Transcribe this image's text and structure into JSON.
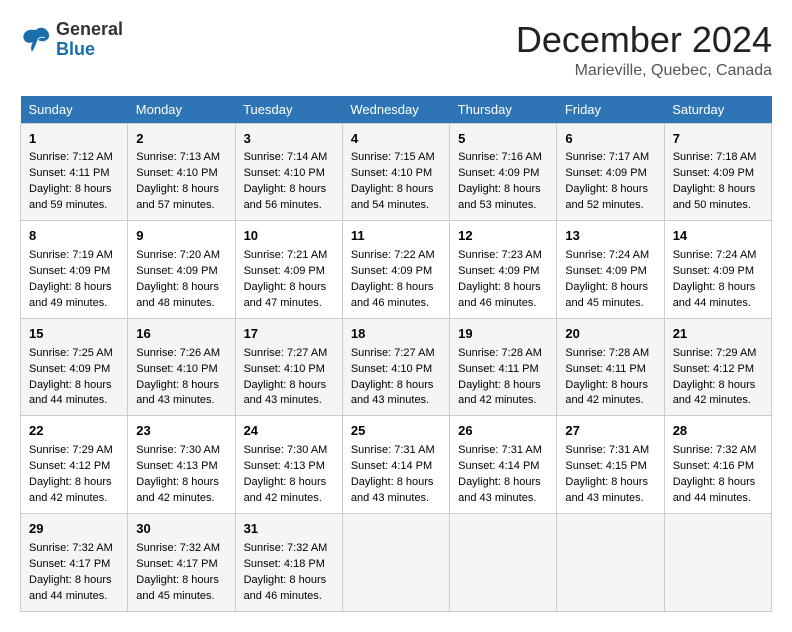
{
  "header": {
    "logo_general": "General",
    "logo_blue": "Blue",
    "month_year": "December 2024",
    "location": "Marieville, Quebec, Canada"
  },
  "days_of_week": [
    "Sunday",
    "Monday",
    "Tuesday",
    "Wednesday",
    "Thursday",
    "Friday",
    "Saturday"
  ],
  "weeks": [
    [
      {
        "day": 1,
        "sunrise": "7:12 AM",
        "sunset": "4:11 PM",
        "daylight": "8 hours and 59 minutes."
      },
      {
        "day": 2,
        "sunrise": "7:13 AM",
        "sunset": "4:10 PM",
        "daylight": "8 hours and 57 minutes."
      },
      {
        "day": 3,
        "sunrise": "7:14 AM",
        "sunset": "4:10 PM",
        "daylight": "8 hours and 56 minutes."
      },
      {
        "day": 4,
        "sunrise": "7:15 AM",
        "sunset": "4:10 PM",
        "daylight": "8 hours and 54 minutes."
      },
      {
        "day": 5,
        "sunrise": "7:16 AM",
        "sunset": "4:09 PM",
        "daylight": "8 hours and 53 minutes."
      },
      {
        "day": 6,
        "sunrise": "7:17 AM",
        "sunset": "4:09 PM",
        "daylight": "8 hours and 52 minutes."
      },
      {
        "day": 7,
        "sunrise": "7:18 AM",
        "sunset": "4:09 PM",
        "daylight": "8 hours and 50 minutes."
      }
    ],
    [
      {
        "day": 8,
        "sunrise": "7:19 AM",
        "sunset": "4:09 PM",
        "daylight": "8 hours and 49 minutes."
      },
      {
        "day": 9,
        "sunrise": "7:20 AM",
        "sunset": "4:09 PM",
        "daylight": "8 hours and 48 minutes."
      },
      {
        "day": 10,
        "sunrise": "7:21 AM",
        "sunset": "4:09 PM",
        "daylight": "8 hours and 47 minutes."
      },
      {
        "day": 11,
        "sunrise": "7:22 AM",
        "sunset": "4:09 PM",
        "daylight": "8 hours and 46 minutes."
      },
      {
        "day": 12,
        "sunrise": "7:23 AM",
        "sunset": "4:09 PM",
        "daylight": "8 hours and 46 minutes."
      },
      {
        "day": 13,
        "sunrise": "7:24 AM",
        "sunset": "4:09 PM",
        "daylight": "8 hours and 45 minutes."
      },
      {
        "day": 14,
        "sunrise": "7:24 AM",
        "sunset": "4:09 PM",
        "daylight": "8 hours and 44 minutes."
      }
    ],
    [
      {
        "day": 15,
        "sunrise": "7:25 AM",
        "sunset": "4:09 PM",
        "daylight": "8 hours and 44 minutes."
      },
      {
        "day": 16,
        "sunrise": "7:26 AM",
        "sunset": "4:10 PM",
        "daylight": "8 hours and 43 minutes."
      },
      {
        "day": 17,
        "sunrise": "7:27 AM",
        "sunset": "4:10 PM",
        "daylight": "8 hours and 43 minutes."
      },
      {
        "day": 18,
        "sunrise": "7:27 AM",
        "sunset": "4:10 PM",
        "daylight": "8 hours and 43 minutes."
      },
      {
        "day": 19,
        "sunrise": "7:28 AM",
        "sunset": "4:11 PM",
        "daylight": "8 hours and 42 minutes."
      },
      {
        "day": 20,
        "sunrise": "7:28 AM",
        "sunset": "4:11 PM",
        "daylight": "8 hours and 42 minutes."
      },
      {
        "day": 21,
        "sunrise": "7:29 AM",
        "sunset": "4:12 PM",
        "daylight": "8 hours and 42 minutes."
      }
    ],
    [
      {
        "day": 22,
        "sunrise": "7:29 AM",
        "sunset": "4:12 PM",
        "daylight": "8 hours and 42 minutes."
      },
      {
        "day": 23,
        "sunrise": "7:30 AM",
        "sunset": "4:13 PM",
        "daylight": "8 hours and 42 minutes."
      },
      {
        "day": 24,
        "sunrise": "7:30 AM",
        "sunset": "4:13 PM",
        "daylight": "8 hours and 42 minutes."
      },
      {
        "day": 25,
        "sunrise": "7:31 AM",
        "sunset": "4:14 PM",
        "daylight": "8 hours and 43 minutes."
      },
      {
        "day": 26,
        "sunrise": "7:31 AM",
        "sunset": "4:14 PM",
        "daylight": "8 hours and 43 minutes."
      },
      {
        "day": 27,
        "sunrise": "7:31 AM",
        "sunset": "4:15 PM",
        "daylight": "8 hours and 43 minutes."
      },
      {
        "day": 28,
        "sunrise": "7:32 AM",
        "sunset": "4:16 PM",
        "daylight": "8 hours and 44 minutes."
      }
    ],
    [
      {
        "day": 29,
        "sunrise": "7:32 AM",
        "sunset": "4:17 PM",
        "daylight": "8 hours and 44 minutes."
      },
      {
        "day": 30,
        "sunrise": "7:32 AM",
        "sunset": "4:17 PM",
        "daylight": "8 hours and 45 minutes."
      },
      {
        "day": 31,
        "sunrise": "7:32 AM",
        "sunset": "4:18 PM",
        "daylight": "8 hours and 46 minutes."
      },
      null,
      null,
      null,
      null
    ]
  ]
}
